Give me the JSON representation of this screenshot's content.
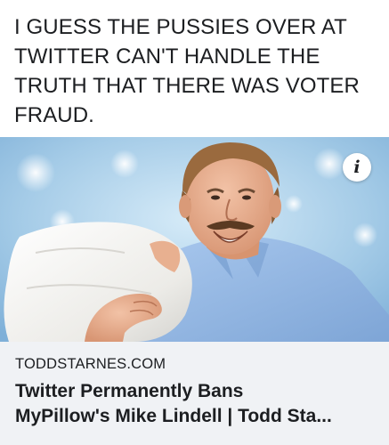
{
  "post": {
    "text": "I GUESS THE PUSSIES OVER AT\nTWITTER CAN'T HANDLE THE\nTRUTH THAT THERE WAS VOTER\nFRAUD."
  },
  "link_preview": {
    "image_icon": "info-icon",
    "info_glyph": "i",
    "domain": "TODDSTARNES.COM",
    "headline": "Twitter Permanently Bans\nMyPillow's Mike Lindell | Todd Sta..."
  },
  "colors": {
    "text": "#1c1e21",
    "meta_background": "#f0f2f5",
    "sky_background": "#a9d0ea",
    "shirt": "#8fb6e6",
    "pillow": "#f4f4f2"
  }
}
